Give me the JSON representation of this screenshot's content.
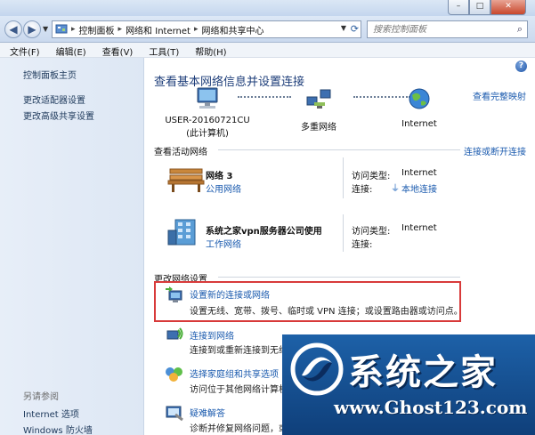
{
  "window": {
    "buttons": {
      "minimize": "–",
      "maximize": "□",
      "close": "✕"
    }
  },
  "address": {
    "crumbs": [
      "控制面板",
      "网络和 Internet",
      "网络和共享中心"
    ],
    "search_placeholder": "搜索控制面板"
  },
  "menu": [
    "文件(F)",
    "编辑(E)",
    "查看(V)",
    "工具(T)",
    "帮助(H)"
  ],
  "sidebar": {
    "links": [
      "控制面板主页",
      "更改适配器设置",
      "更改高级共享设置"
    ],
    "see_also_heading": "另请参阅",
    "see_also": [
      "Internet 选项",
      "Windows 防火墙"
    ]
  },
  "main": {
    "title": "查看基本网络信息并设置连接",
    "full_map_link": "查看完整映射",
    "map": {
      "computer_name": "USER-20160721CU",
      "computer_sub": "(此计算机)",
      "network": "多重网络",
      "internet": "Internet"
    },
    "active_networks_heading": "查看活动网络",
    "connect_disconnect_link": "连接或断开连接",
    "networks": [
      {
        "name": "网络  3",
        "type_link": "公用网络",
        "access_label": "访问类型:",
        "access_value": "Internet",
        "conn_label": "连接:",
        "conn_value": "本地连接"
      },
      {
        "name": "系统之家vpn服务器公司使用",
        "type_link": "工作网络",
        "access_label": "访问类型:",
        "access_value": "Internet",
        "conn_label": "连接:",
        "conn_value": ""
      }
    ],
    "change_settings_heading": "更改网络设置",
    "tasks": [
      {
        "title": "设置新的连接或网络",
        "desc": "设置无线、宽带、拨号、临时或 VPN 连接；或设置路由器或访问点。"
      },
      {
        "title": "连接到网络",
        "desc": "连接到或重新连接到无线"
      },
      {
        "title": "选择家庭组和共享选项",
        "desc": "访问位于其他网络计算机"
      },
      {
        "title": "疑难解答",
        "desc": "诊断并修复网络问题，或"
      }
    ]
  },
  "watermark": {
    "brand": "系统之家",
    "url": "www.Ghost123.com"
  }
}
